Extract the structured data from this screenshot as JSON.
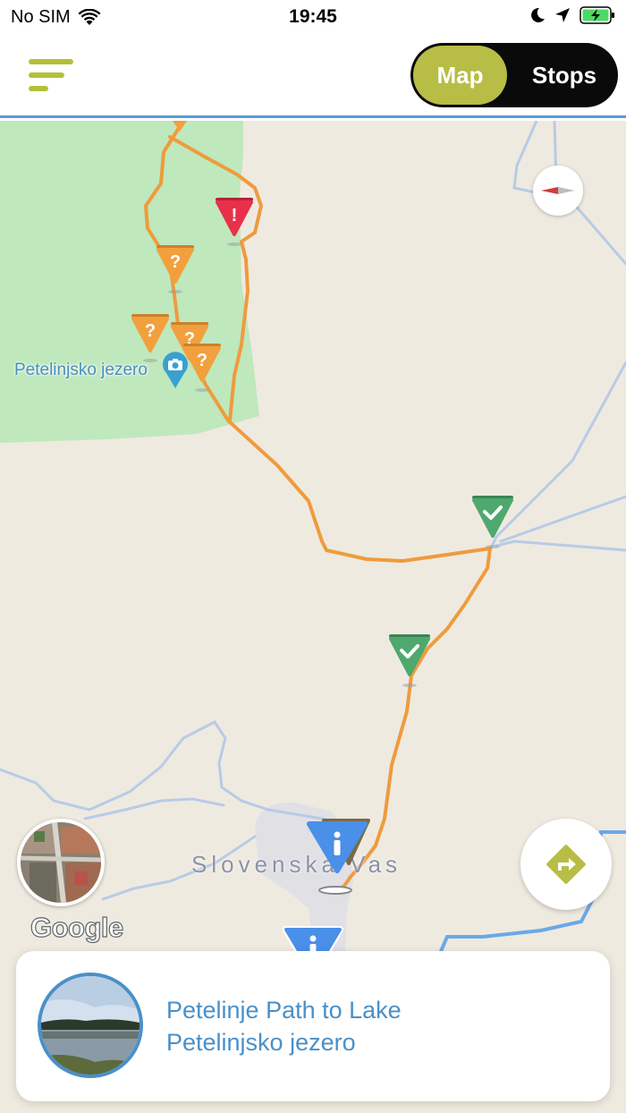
{
  "status_bar": {
    "carrier": "No SIM",
    "time": "19:45",
    "icons": [
      "wifi-icon",
      "moon-icon",
      "location-arrow-icon",
      "battery-charging-icon"
    ]
  },
  "header": {
    "menu_icon": "hamburger-menu-icon",
    "tabs": [
      {
        "label": "Map",
        "selected": true
      },
      {
        "label": "Stops",
        "selected": false
      }
    ],
    "accent_color": "#b7bd45"
  },
  "map": {
    "poi_label": "Petelinjsko jezero",
    "town_label": "Slovenska Vas",
    "attribution": "Google",
    "route_color": "#ef9b3d",
    "markers": [
      {
        "type": "question",
        "color": "#f2a03d",
        "icon": "question-mark-icon"
      },
      {
        "type": "warning",
        "color": "#e8304a",
        "icon": "exclamation-icon"
      },
      {
        "type": "completed",
        "color": "#4fa86e",
        "icon": "checkmark-icon"
      },
      {
        "type": "info",
        "color": "#4a8fe8",
        "icon": "info-icon"
      },
      {
        "type": "photo",
        "color": "#3aa0d0",
        "icon": "camera-icon"
      }
    ],
    "controls": [
      "compass-icon",
      "street-view-thumbnail",
      "directions-icon"
    ]
  },
  "card": {
    "title_line1": "Petelinje Path to Lake",
    "title_line2": "Petelinjsko jezero",
    "accent_color": "#4a90c8"
  }
}
